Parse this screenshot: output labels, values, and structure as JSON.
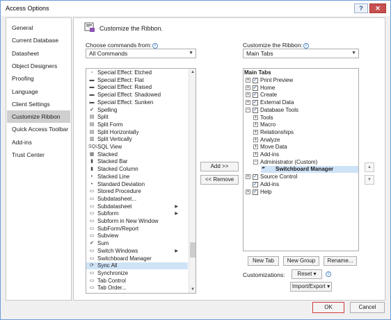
{
  "window": {
    "title": "Access Options",
    "help": "?",
    "close": "✕"
  },
  "nav": {
    "items": [
      {
        "label": "General"
      },
      {
        "label": "Current Database"
      },
      {
        "label": "Datasheet"
      },
      {
        "label": "Object Designers"
      },
      {
        "label": "Proofing"
      },
      {
        "label": "Language"
      },
      {
        "label": "Client Settings"
      },
      {
        "label": "Customize Ribbon",
        "selected": true
      },
      {
        "label": "Quick Access Toolbar"
      },
      {
        "label": "Add-ins"
      },
      {
        "label": "Trust Center"
      }
    ]
  },
  "header": {
    "title": "Customize the Ribbon."
  },
  "left": {
    "label": "Choose commands from:",
    "value": "All Commands",
    "commands": [
      {
        "icon": "▫",
        "label": "Special Effect: Etched"
      },
      {
        "icon": "▬",
        "label": "Special Effect: Flat"
      },
      {
        "icon": "▬",
        "label": "Special Effect: Raised"
      },
      {
        "icon": "▬",
        "label": "Special Effect: Shadowed"
      },
      {
        "icon": "▬",
        "label": "Special Effect: Sunken"
      },
      {
        "icon": "✔",
        "label": "Spelling"
      },
      {
        "icon": "▤",
        "label": "Split"
      },
      {
        "icon": "▤",
        "label": "Split Form"
      },
      {
        "icon": "▤",
        "label": "Split Horizontally"
      },
      {
        "icon": "▥",
        "label": "Split Vertically"
      },
      {
        "icon": "SQL",
        "label": "SQL View"
      },
      {
        "icon": "▦",
        "label": "Stacked"
      },
      {
        "icon": "▮",
        "label": "Stacked Bar"
      },
      {
        "icon": "▮",
        "label": "Stacked Column"
      },
      {
        "icon": "•",
        "label": "Stacked Line"
      },
      {
        "icon": "•",
        "label": "Standard Deviation"
      },
      {
        "icon": "▭",
        "label": "Stored Procedure"
      },
      {
        "icon": "▭",
        "label": "Subdatasheet..."
      },
      {
        "icon": "▭",
        "label": "Subdatasheet",
        "submenu": true
      },
      {
        "icon": "▭",
        "label": "Subform",
        "submenu": true
      },
      {
        "icon": "▭",
        "label": "Subform in New Window"
      },
      {
        "icon": "▭",
        "label": "SubForm/Report"
      },
      {
        "icon": "▭",
        "label": "Subview"
      },
      {
        "icon": "✔",
        "label": "Sum"
      },
      {
        "icon": "▭",
        "label": "Switch Windows",
        "submenu": true
      },
      {
        "icon": "▭",
        "label": "Switchboard Manager"
      },
      {
        "icon": "⟳",
        "label": "Sync All",
        "selected": true
      },
      {
        "icon": "▭",
        "label": "Synchronize"
      },
      {
        "icon": "▭",
        "label": "Tab Control"
      },
      {
        "icon": "▭",
        "label": "Tab Order..."
      }
    ]
  },
  "middle": {
    "add": "Add >>",
    "remove": "<< Remove"
  },
  "right": {
    "label": "Customize the Ribbon:",
    "value": "Main Tabs",
    "tree_header": "Main Tabs",
    "tree": [
      {
        "indent": 0,
        "exp": "+",
        "check": true,
        "label": "Print Preview"
      },
      {
        "indent": 0,
        "exp": "+",
        "check": true,
        "label": "Home"
      },
      {
        "indent": 0,
        "exp": "+",
        "check": true,
        "label": "Create"
      },
      {
        "indent": 0,
        "exp": "+",
        "check": true,
        "label": "External Data"
      },
      {
        "indent": 0,
        "exp": "−",
        "check": true,
        "label": "Database Tools"
      },
      {
        "indent": 1,
        "exp": "+",
        "check": false,
        "label": "Tools"
      },
      {
        "indent": 1,
        "exp": "+",
        "check": false,
        "label": "Macro"
      },
      {
        "indent": 1,
        "exp": "+",
        "check": false,
        "label": "Relationships"
      },
      {
        "indent": 1,
        "exp": "+",
        "check": false,
        "label": "Analyze"
      },
      {
        "indent": 1,
        "exp": "+",
        "check": false,
        "label": "Move Data"
      },
      {
        "indent": 1,
        "exp": "+",
        "check": false,
        "label": "Add-ins"
      },
      {
        "indent": 1,
        "exp": "−",
        "check": false,
        "label": "Administrator (Custom)"
      },
      {
        "indent": 2,
        "exp": "",
        "check": false,
        "label": "Switchboard Manager",
        "selected": true
      },
      {
        "indent": 0,
        "exp": "+",
        "check": true,
        "label": "Source Control"
      },
      {
        "indent": 0,
        "exp": "",
        "check": true,
        "label": "Add-ins"
      },
      {
        "indent": 0,
        "exp": "+",
        "check": true,
        "label": "Help"
      }
    ],
    "new_tab": "New Tab",
    "new_group": "New Group",
    "rename": "Rename...",
    "customizations_label": "Customizations:",
    "reset": "Reset ▾",
    "import_export": "Import/Export ▾"
  },
  "footer": {
    "ok": "OK",
    "cancel": "Cancel"
  }
}
